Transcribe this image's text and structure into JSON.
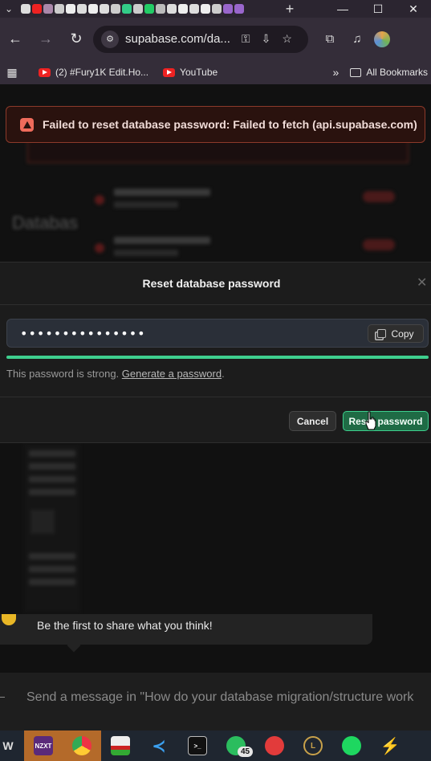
{
  "browser": {
    "url": "supabase.com/da...",
    "bookmarks": [
      {
        "label": "(2) #Fury1K Edit.Ho...",
        "icon": "youtube-icon"
      },
      {
        "label": "YouTube",
        "icon": "youtube-icon"
      }
    ],
    "more_bookmarks": "»",
    "all_bookmarks": "All Bookmarks"
  },
  "toast": {
    "message": "Failed to reset database password: Failed to fetch (api.supabase.com)",
    "icon": "alert-triangle-icon",
    "color": "#ef6b5b"
  },
  "background": {
    "section_title": "Databas"
  },
  "modal": {
    "title": "Reset database password",
    "password_value": "•••••••••••••••",
    "copy_label": "Copy",
    "strength_fraction": 1.0,
    "strength_color": "#3ecf8e",
    "strength_text": "This password is strong.",
    "generate_link": "Generate a password",
    "strength_suffix": ".",
    "cancel_label": "Cancel",
    "submit_label": "Reset password"
  },
  "feedback": {
    "text": "Be the first to share what you think!"
  },
  "message_input": {
    "placeholder": "Send a message in \"How do your database migration/structure work"
  },
  "taskbar": {
    "items": [
      {
        "name": "w-app",
        "label": "W"
      },
      {
        "name": "nzxt",
        "label": "NZXT"
      },
      {
        "name": "chrome"
      },
      {
        "name": "app-window"
      },
      {
        "name": "vscode"
      },
      {
        "name": "terminal"
      },
      {
        "name": "whatsapp",
        "badge": "45"
      },
      {
        "name": "riot-client"
      },
      {
        "name": "league-of-legends"
      },
      {
        "name": "spotify"
      },
      {
        "name": "zap-app"
      }
    ]
  }
}
